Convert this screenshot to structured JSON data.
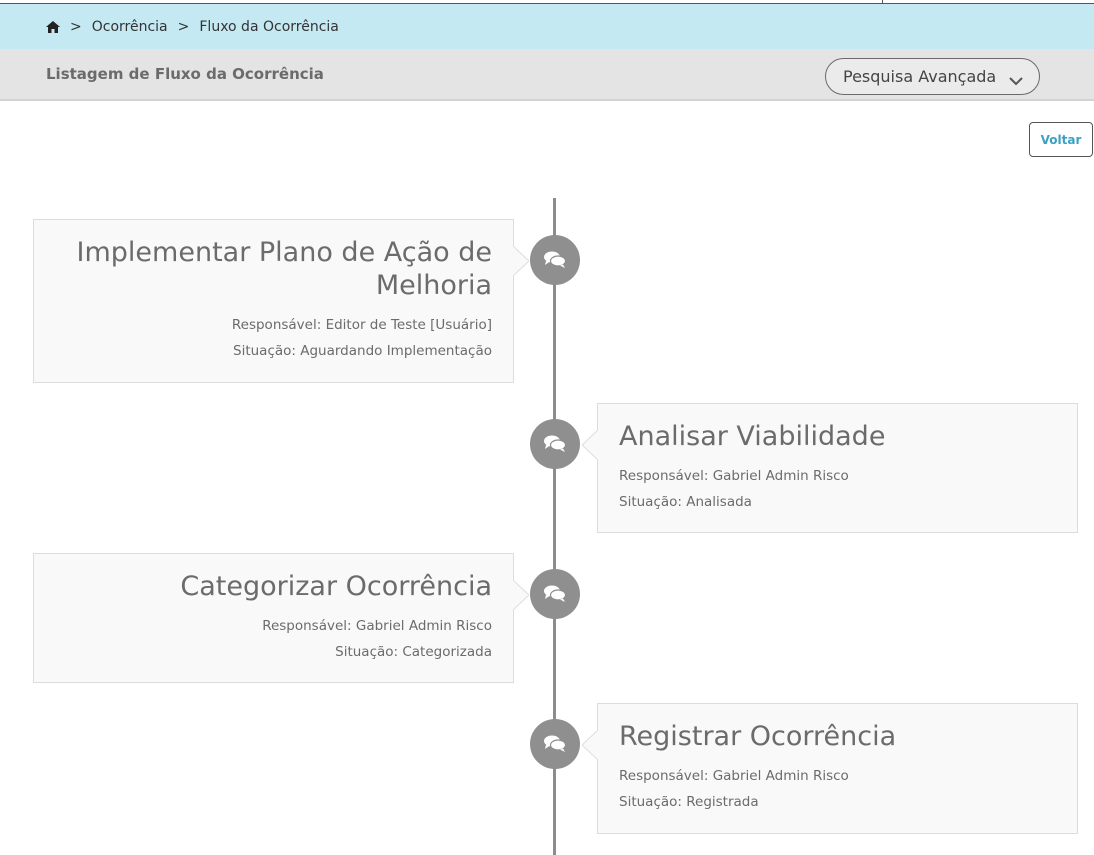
{
  "breadcrumb": {
    "home_icon": "home-icon",
    "separator": ">",
    "items": [
      "Ocorrência",
      "Fluxo da Ocorrência"
    ]
  },
  "header": {
    "title": "Listagem de Fluxo da Ocorrência",
    "advanced_search_label": "Pesquisa Avançada"
  },
  "actions": {
    "back_label": "Voltar"
  },
  "timeline": {
    "node_icon": "comments-icon",
    "responsavel_prefix": "Responsável:",
    "situacao_prefix": "Situação:",
    "items": [
      {
        "title": "Implementar Plano de Ação de Melhoria",
        "responsavel": "Responsável: Editor de Teste [Usuário]",
        "situacao": "Situação: Aguardando Implementação"
      },
      {
        "title": "Analisar Viabilidade",
        "responsavel": "Responsável: Gabriel Admin Risco",
        "situacao": "Situação: Analisada"
      },
      {
        "title": "Categorizar Ocorrência",
        "responsavel": "Responsável: Gabriel Admin Risco",
        "situacao": "Situação: Categorizada"
      },
      {
        "title": "Registrar Ocorrência",
        "responsavel": "Responsável: Gabriel Admin Risco",
        "situacao": "Situação: Registrada"
      }
    ]
  },
  "colors": {
    "breadcrumb_bg": "#c4e9f2",
    "header_bg": "#e4e4e4",
    "accent": "#3ba0c4",
    "node": "#8f8f8f"
  }
}
